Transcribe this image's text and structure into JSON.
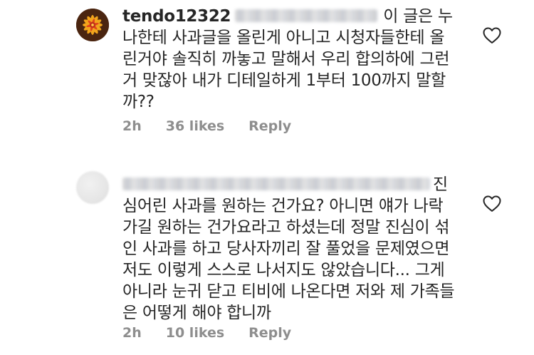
{
  "comments": [
    {
      "username": "tendo12322",
      "text_lines": [
        "이 글은 누",
        "나한테 사과글을 올린게 아니고 시청자들한테 올",
        "린거야 솔직히 까놓고 말해서 우리 합의하에 그런",
        "거 맞잖아 내가 디테일하게 1부터 100까지 말할",
        "까??"
      ],
      "time": "2h",
      "likes": "36 likes",
      "reply_label": "Reply"
    },
    {
      "username": "",
      "text_lines": [
        "진",
        "심어린 사과를 원하는 건가요? 아니면 얘가 나락",
        "가길 원하는 건가요라고 하셨는데 정말 진심이 섞",
        "인 사과를 하고 당사자끼리 잘 풀었을 문제였으면",
        "저도 이렇게 스스로 나서지도 않았습니다... 그게",
        "아니라 눈귀 닫고 티비에 나온다면 저와 제 가족들",
        "은 어떻게 해야 합니까"
      ],
      "time": "2h",
      "likes": "10 likes",
      "reply_label": "Reply"
    }
  ],
  "icons": {
    "like": "heart-outline-icon"
  },
  "colors": {
    "text": "#262626",
    "meta": "#8e8e8e",
    "background": "#ffffff"
  }
}
